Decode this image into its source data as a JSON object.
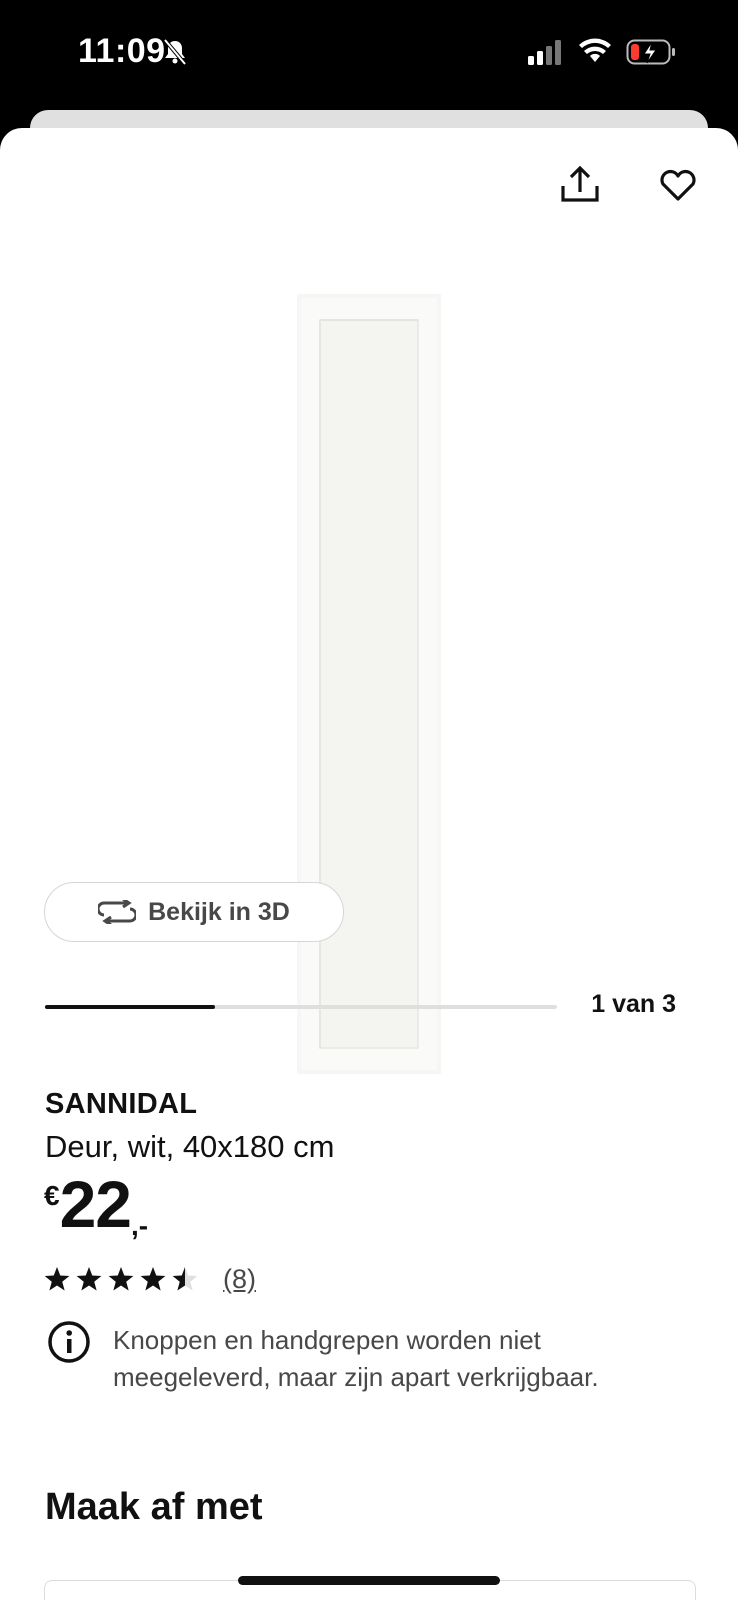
{
  "status_bar": {
    "time": "11:09"
  },
  "header": {
    "share_icon": "share-icon",
    "favorite_icon": "heart-icon"
  },
  "gallery": {
    "view_3d_label": "Bekijk in 3D",
    "counter": "1 van 3",
    "progress_fraction": 0.333
  },
  "product": {
    "name": "SANNIDAL",
    "description": "Deur, wit, 40x180 cm",
    "price": {
      "currency": "€",
      "value": "22",
      "suffix": ",-"
    },
    "rating": {
      "stars": 4.5,
      "max": 5,
      "count_label": "(8)"
    },
    "note": "Knoppen en handgrepen worden niet meegeleverd, maar zijn apart verkrijgbaar."
  },
  "section": {
    "title": "Maak af met"
  },
  "colors": {
    "text": "#111111",
    "muted": "#484848",
    "track": "#dfdfdf"
  }
}
